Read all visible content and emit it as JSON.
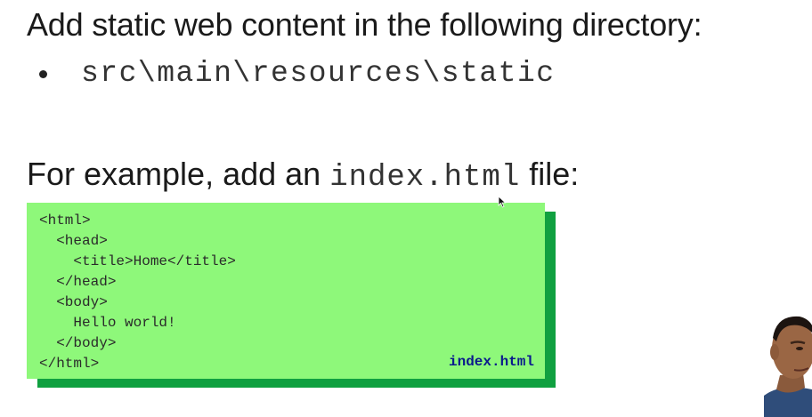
{
  "slide": {
    "heading_1": "Add static web content in the following directory:",
    "bullet_path": "src\\main\\resources\\static",
    "heading_2_prefix": "For example, add an",
    "heading_2_code": "index.html",
    "heading_2_suffix": "file:"
  },
  "code_block": {
    "lines": [
      "<html>",
      "  <head>",
      "    <title>Home</title>",
      "  </head>",
      "  <body>",
      "    Hello world!",
      "  </body>",
      "</html>"
    ],
    "file_label": "index.html"
  },
  "colors": {
    "code_bg": "#8ef87a",
    "code_shadow": "#10a040",
    "file_label": "#0a1a8c"
  },
  "icons": {
    "bullet": "bullet-dot",
    "cursor": "mouse-pointer-icon"
  }
}
